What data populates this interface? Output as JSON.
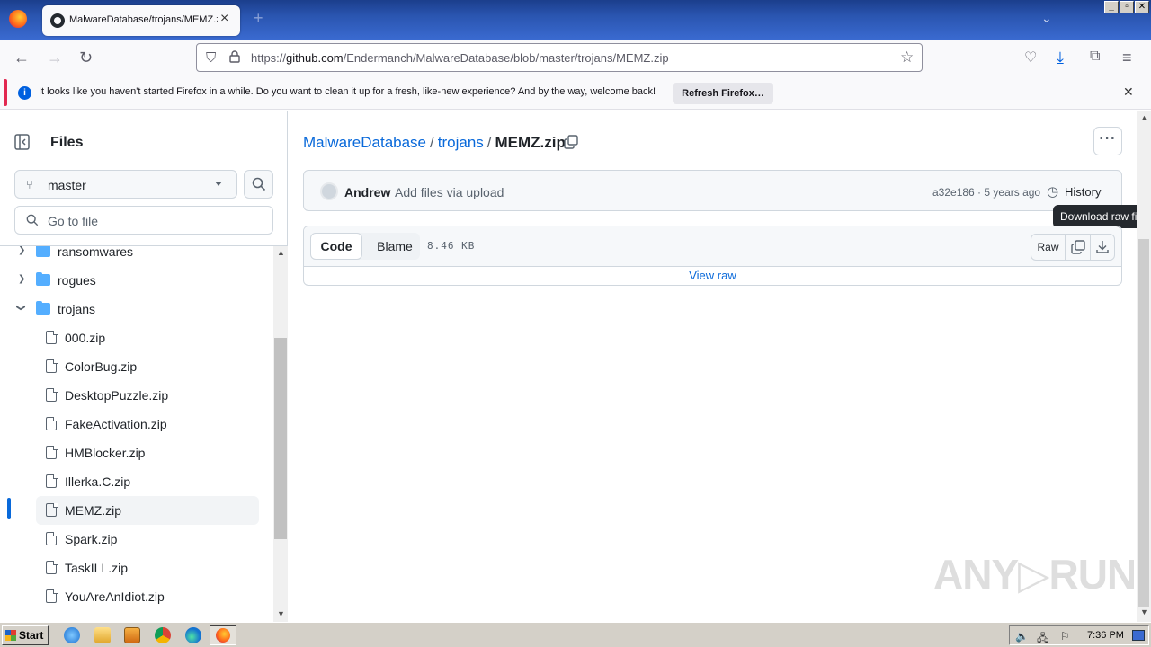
{
  "browser": {
    "tab_title": "MalwareDatabase/trojans/MEMZ.zip",
    "new_tab": "+",
    "tabs_menu": "⌄",
    "url_prefix": "https://",
    "url_domain": "github.com",
    "url_path": "/Endermanch/MalwareDatabase/blob/master/trojans/MEMZ.zip",
    "window_buttons": [
      "_",
      "▫",
      "✕"
    ]
  },
  "notification": {
    "message": "It looks like you haven't started Firefox in a while. Do you want to clean it up for a fresh, like-new experience? And by the way, welcome back!",
    "button": "Refresh Firefox…"
  },
  "sidebar": {
    "title": "Files",
    "branch": "master",
    "goto_placeholder": "Go to file",
    "tree": [
      {
        "name": "ransomwares",
        "type": "folder",
        "expanded": false
      },
      {
        "name": "rogues",
        "type": "folder",
        "expanded": false
      },
      {
        "name": "trojans",
        "type": "folder",
        "expanded": true
      },
      {
        "name": "000.zip",
        "type": "file"
      },
      {
        "name": "ColorBug.zip",
        "type": "file"
      },
      {
        "name": "DesktopPuzzle.zip",
        "type": "file"
      },
      {
        "name": "FakeActivation.zip",
        "type": "file"
      },
      {
        "name": "HMBlocker.zip",
        "type": "file"
      },
      {
        "name": "Illerka.C.zip",
        "type": "file"
      },
      {
        "name": "MEMZ.zip",
        "type": "file",
        "selected": true
      },
      {
        "name": "Spark.zip",
        "type": "file"
      },
      {
        "name": "TaskILL.zip",
        "type": "file"
      },
      {
        "name": "YouAreAnIdiot.zip",
        "type": "file"
      }
    ]
  },
  "breadcrumb": {
    "repo": "MalwareDatabase",
    "folder": "trojans",
    "separator": "/",
    "file": "MEMZ.zip"
  },
  "commit": {
    "author": "Andrew",
    "message": "Add files via upload",
    "sha_time": "a32e186 · 5 years ago",
    "history": "History"
  },
  "tooltip": "Download raw file",
  "viewer": {
    "code_tab": "Code",
    "blame_tab": "Blame",
    "size": "8.46 KB",
    "raw": "Raw",
    "view_raw": "View raw"
  },
  "watermark": "ANY▷RUN",
  "taskbar": {
    "start": "Start",
    "clock": "7:36 PM"
  },
  "colors": {
    "link": "#0969da",
    "folder": "#54aeff",
    "accent_selected": "#0969da",
    "notification_accent": "#e22850"
  }
}
